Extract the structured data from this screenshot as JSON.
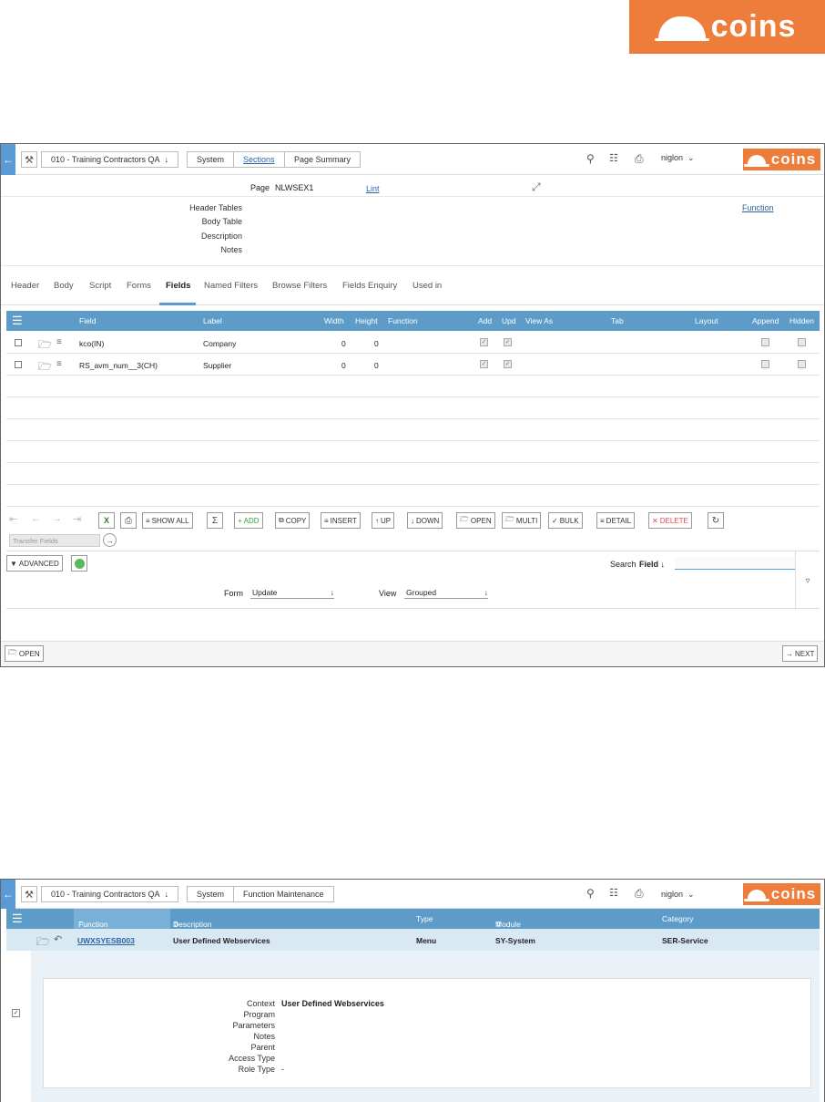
{
  "brand": {
    "logo_text": "coins",
    "color": "#ee7c3b"
  },
  "accent": "#5b9bd5",
  "screen1": {
    "breadcrumbs": [
      "010 - Training Contractors QA",
      "System",
      "Sections",
      "Page Summary"
    ],
    "user": "niglon",
    "page_label": "Page",
    "page_value": "NLWSEX1",
    "page_link": "Lint",
    "header_fields": {
      "header_tables": "Header Tables",
      "body_table": "Body Table",
      "description": "Description",
      "notes": "Notes"
    },
    "function_link": "Function",
    "tabs": [
      "Header",
      "Body",
      "Script",
      "Forms",
      "Fields",
      "Named Filters",
      "Browse Filters",
      "Fields Enquiry",
      "Used in"
    ],
    "active_tab": "Fields",
    "columns": {
      "field": "Field",
      "label": "Label",
      "width": "Width",
      "height": "Height",
      "function": "Function",
      "add": "Add",
      "upd": "Upd",
      "view_as": "View As",
      "tab": "Tab",
      "layout": "Layout",
      "append": "Append",
      "hidden": "Hidden"
    },
    "rows": [
      {
        "field": "kco(IN)",
        "label": "Company",
        "width": "0",
        "height": "0",
        "add": true,
        "upd": true
      },
      {
        "field": "RS_avm_num__3(CH)",
        "label": "Supplier",
        "width": "0",
        "height": "0",
        "add": true,
        "upd": true
      }
    ],
    "toolbar": {
      "show_all": "SHOW ALL",
      "add": "ADD",
      "copy": "COPY",
      "insert": "INSERT",
      "up": "UP",
      "down": "DOWN",
      "open": "OPEN",
      "multi": "MULTI",
      "bulk": "BULK",
      "detail": "DETAIL",
      "delete": "DELETE"
    },
    "transfer_placeholder": "Transfer Fields",
    "advanced": "ADVANCED",
    "search_label": "Search",
    "search_field": "Field",
    "form_label": "Form",
    "form_value": "Update",
    "view_label": "View",
    "view_value": "Grouped",
    "open_btn": "OPEN",
    "next_btn": "NEXT"
  },
  "screen2": {
    "breadcrumbs": [
      "010 - Training Contractors QA",
      "System",
      "Function Maintenance"
    ],
    "user": "niglon",
    "columns": {
      "function": "Function",
      "description": "Description",
      "type": "Type",
      "module": "Module",
      "category": "Category"
    },
    "row": {
      "function": "UWXSYESB003",
      "description": "User Defined Webservices",
      "type": "Menu",
      "module": "SY-System",
      "category": "SER-Service"
    },
    "detail_labels": [
      "Context",
      "Program",
      "Parameters",
      "Notes",
      "Parent",
      "Access Type",
      "Role Type"
    ],
    "context_value": "User Defined Webservices",
    "role_type_value": "-"
  }
}
